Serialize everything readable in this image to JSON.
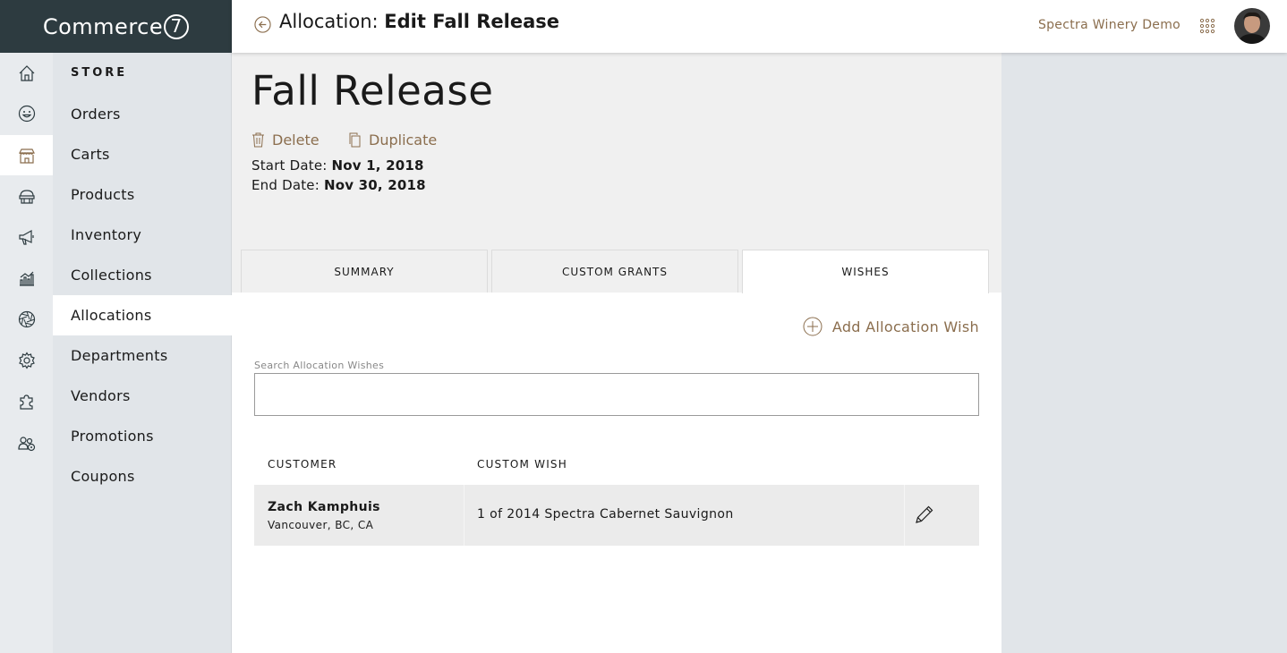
{
  "app": {
    "logo_text": "Commerce",
    "logo_mark": "7"
  },
  "header": {
    "title_prefix": "Allocation:",
    "title_bold": "Edit Fall Release",
    "account_name": "Spectra Winery Demo",
    "icons": [
      "back-arrow-icon",
      "apps-grid-icon",
      "user-avatar"
    ]
  },
  "rail": {
    "items": [
      {
        "icon": "home-icon"
      },
      {
        "icon": "smiley-icon"
      },
      {
        "icon": "store-icon",
        "active": true
      },
      {
        "icon": "club-icon"
      },
      {
        "icon": "megaphone-icon"
      },
      {
        "icon": "reports-icon"
      },
      {
        "icon": "aperture-icon"
      },
      {
        "icon": "settings-gear-icon"
      },
      {
        "icon": "puzzle-icon"
      },
      {
        "icon": "users-settings-icon"
      }
    ]
  },
  "submenu": {
    "title": "STORE",
    "items": [
      {
        "label": "Orders"
      },
      {
        "label": "Carts"
      },
      {
        "label": "Products"
      },
      {
        "label": "Inventory"
      },
      {
        "label": "Collections"
      },
      {
        "label": "Allocations",
        "active": true
      },
      {
        "label": "Departments"
      },
      {
        "label": "Vendors"
      },
      {
        "label": "Promotions"
      },
      {
        "label": "Coupons"
      }
    ]
  },
  "record": {
    "title": "Fall Release",
    "actions": {
      "delete": "Delete",
      "duplicate": "Duplicate"
    },
    "start_label": "Start Date:",
    "start_value": "Nov 1, 2018",
    "end_label": "End Date:",
    "end_value": "Nov 30, 2018"
  },
  "tabs": [
    {
      "label": "SUMMARY"
    },
    {
      "label": "CUSTOM GRANTS"
    },
    {
      "label": "WISHES",
      "active": true
    }
  ],
  "wishes": {
    "add_label": "Add Allocation Wish",
    "search_label": "Search Allocation Wishes",
    "search_value": "",
    "columns": [
      "CUSTOMER",
      "CUSTOM WISH"
    ],
    "rows": [
      {
        "customer_name": "Zach Kamphuis",
        "customer_location": "Vancouver, BC, CA",
        "custom_wish": "1 of 2014 Spectra Cabernet Sauvignon"
      }
    ]
  },
  "colors": {
    "accent": "#8b6e4e",
    "sidebar_dark": "#2d3b40",
    "sidebar_light": "#e1e5e9"
  }
}
